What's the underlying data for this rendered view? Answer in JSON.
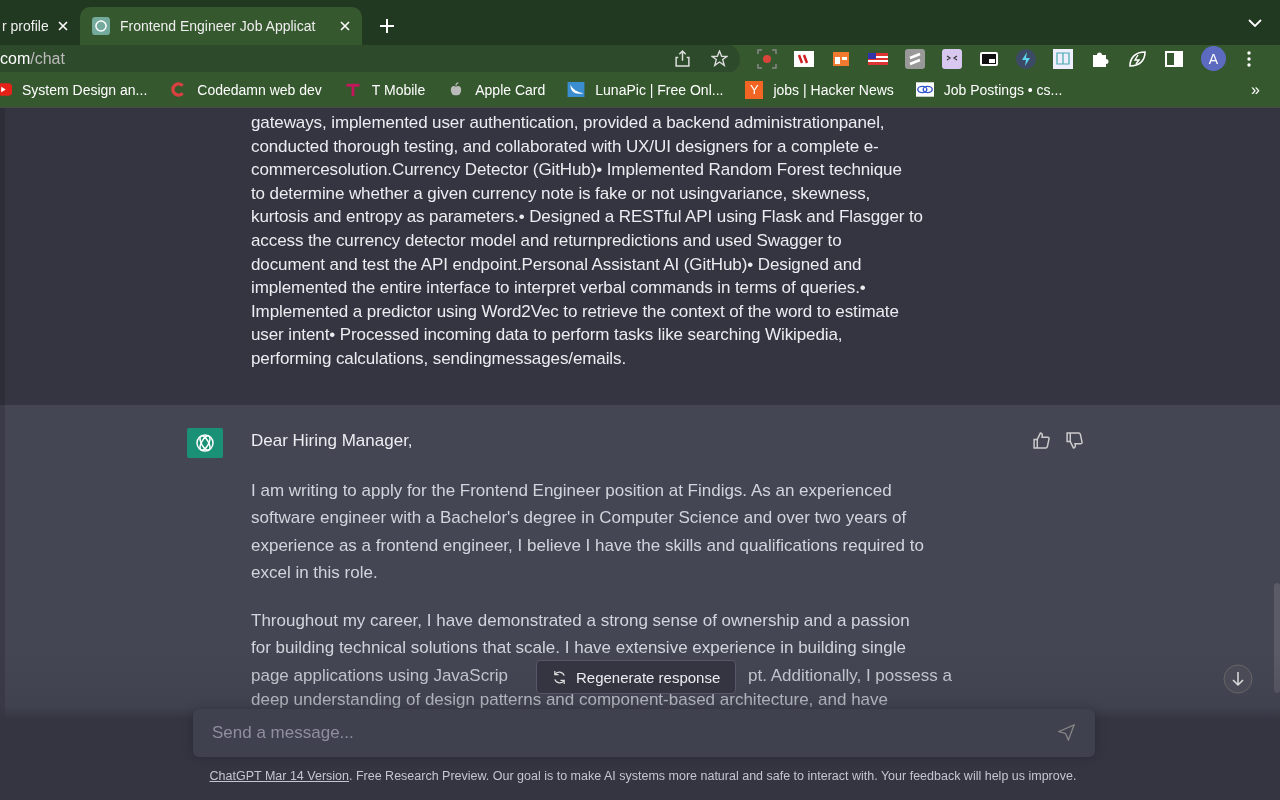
{
  "browser": {
    "tabs": [
      {
        "title": "r profile",
        "selected": false
      },
      {
        "title": "Frontend Engineer Job Applicat",
        "selected": true
      }
    ],
    "url": {
      "host": "com",
      "path": "/chat"
    },
    "profile_initial": "A",
    "bookmarks": [
      {
        "label": "System Design an..."
      },
      {
        "label": "Codedamn web dev"
      },
      {
        "label": "T Mobile"
      },
      {
        "label": "Apple Card"
      },
      {
        "label": "LunaPic | Free Onl..."
      },
      {
        "letter": "Y",
        "label": "jobs | Hacker News"
      },
      {
        "label": "Job Postings • cs..."
      }
    ],
    "bookmarks_more": "»"
  },
  "chat": {
    "user_message": "gateways, implemented user authentication, provided a backend administrationpanel,\nconducted thorough testing, and collaborated with UX/UI designers for a complete e-\ncommercesolution.Currency Detector (GitHub)• Implemented Random Forest technique\nto determine whether a given currency note is fake or not usingvariance, skewness,\nkurtosis and entropy as parameters.• Designed a RESTful API using Flask and Flasgger to\naccess the currency detector model and returnpredictions and used Swagger to\ndocument and test the API endpoint.Personal Assistant AI (GitHub)• Designed and\nimplemented the entire interface to interpret verbal commands in terms of queries.•\nImplemented a predictor using Word2Vec to retrieve the context of the word to estimate\nuser intent• Processed incoming data to perform tasks like searching Wikipedia,\nperforming calculations, sendingmessages/emails.",
    "assistant": {
      "greeting": "Dear Hiring Manager,",
      "paragraph_1": "I am writing to apply for the Frontend Engineer position at Findigs. As an experienced\nsoftware engineer with a Bachelor's degree in Computer Science and over two years of\nexperience as a frontend engineer, I believe I have the skills and qualifications required to\nexcel in this role.",
      "paragraph_2": "Throughout my career, I have demonstrated a strong sense of ownership and a passion\nfor building technical solutions that scale. I have extensive experience in building single",
      "paragraph_2_line_3_left": "page applications using JavaScrip",
      "paragraph_2_line_3_right": "pt. Additionally, I possess a",
      "paragraph_2_line_4": "deep understanding of design patterns and component-based architecture, and have"
    },
    "regenerate_button": "Regenerate response",
    "input": {
      "placeholder": "Send a message..."
    },
    "footer": {
      "link": "ChatGPT Mar 14 Version",
      "text": ". Free Research Preview. Our goal is to make AI systems more natural and safe to interact with. Your feedback will help us improve."
    }
  }
}
